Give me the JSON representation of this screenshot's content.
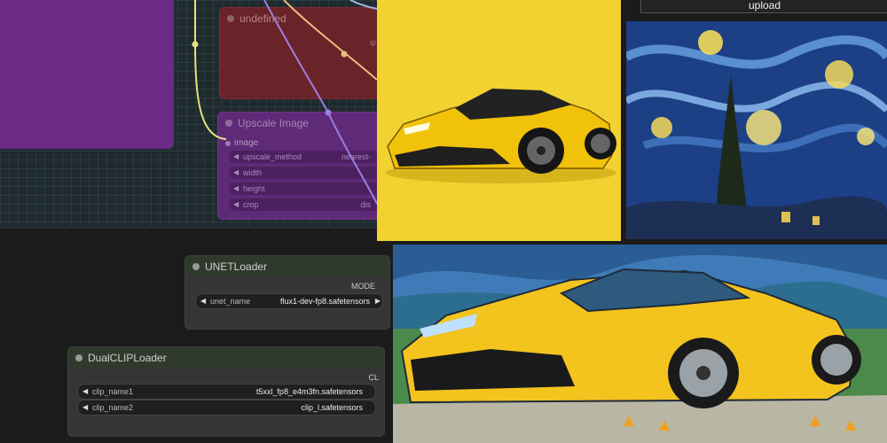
{
  "nodes": {
    "undefined_node": {
      "title": "undefined",
      "output_label": "ip"
    },
    "upscale_image": {
      "title": "Upscale Image",
      "input_image": "image",
      "widgets": [
        {
          "label": "upscale_method",
          "value": "nearest-"
        },
        {
          "label": "width",
          "value": ""
        },
        {
          "label": "height",
          "value": ""
        },
        {
          "label": "crop",
          "value": "dis"
        }
      ]
    },
    "unet_loader": {
      "title": "UNETLoader",
      "output_label": "MODE",
      "field": {
        "label": "unet_name",
        "value": "flux1-dev-fp8.safetensors"
      }
    },
    "dual_clip_loader": {
      "title": "DualCLIPLoader",
      "output_label": "CL",
      "fields": [
        {
          "label": "clip_name1",
          "value": "t5xxl_fp8_e4m3fn.safetensors"
        },
        {
          "label": "clip_name2",
          "value": "clip_l.safetensors"
        }
      ]
    }
  },
  "upload_button": {
    "label": "upload"
  },
  "images": [
    {
      "name": "yellow-sports-car-image"
    },
    {
      "name": "starry-night-image"
    },
    {
      "name": "van-gogh-style-car-image"
    }
  ],
  "colors": {
    "canvas_grid": "#1f2a2e",
    "red_node": "#6a2329",
    "purple_node": "#5f2a78",
    "dark_node": "#353535",
    "wire_yellow": "#e8e07a",
    "wire_purple": "#9a7ee0"
  }
}
